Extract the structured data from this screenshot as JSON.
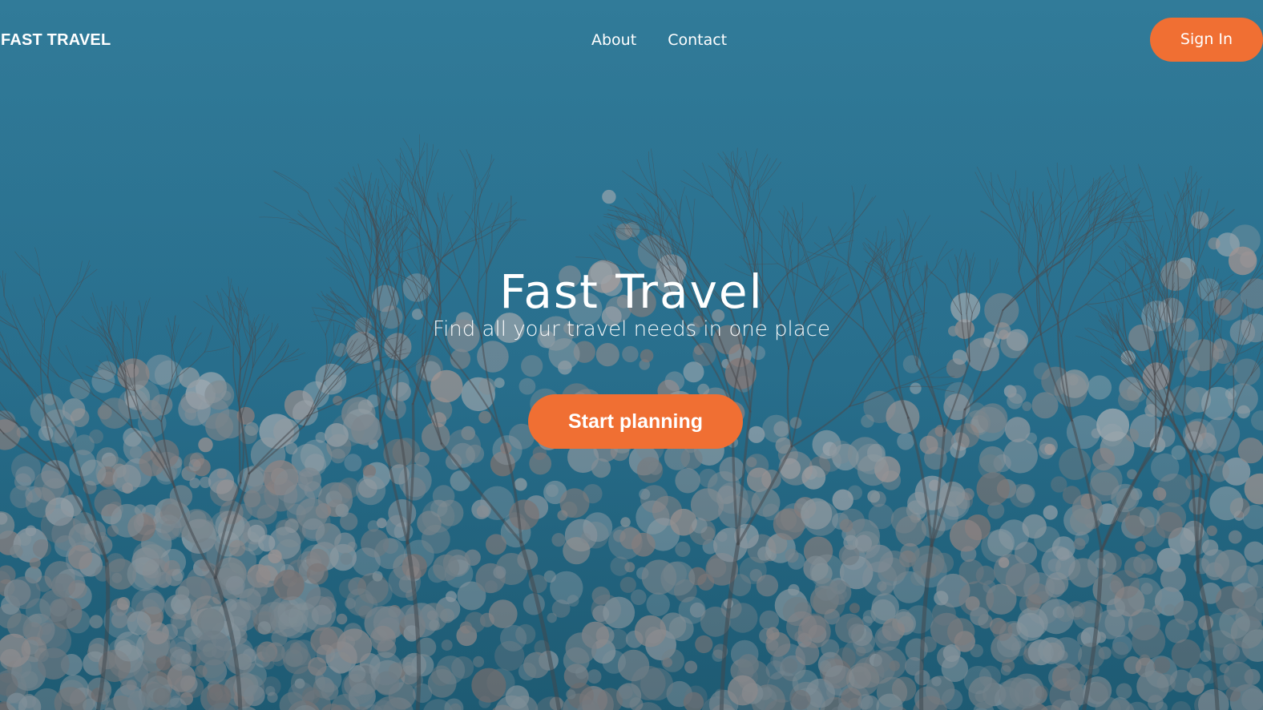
{
  "nav": {
    "brand": "FAST TRAVEL",
    "links": [
      "About",
      "Contact"
    ],
    "signin_label": "Sign In"
  },
  "hero": {
    "title": "Fast Travel",
    "subtitle": "Find all your travel needs in one place",
    "cta_label": "Start planning",
    "background": "cherry-blossom-trees-image"
  },
  "colors": {
    "accent": "#f06f33",
    "sky_top": "#2f7896",
    "sky_bottom": "#226a86",
    "blossom": "#8a96a0",
    "text": "#ffffff"
  }
}
